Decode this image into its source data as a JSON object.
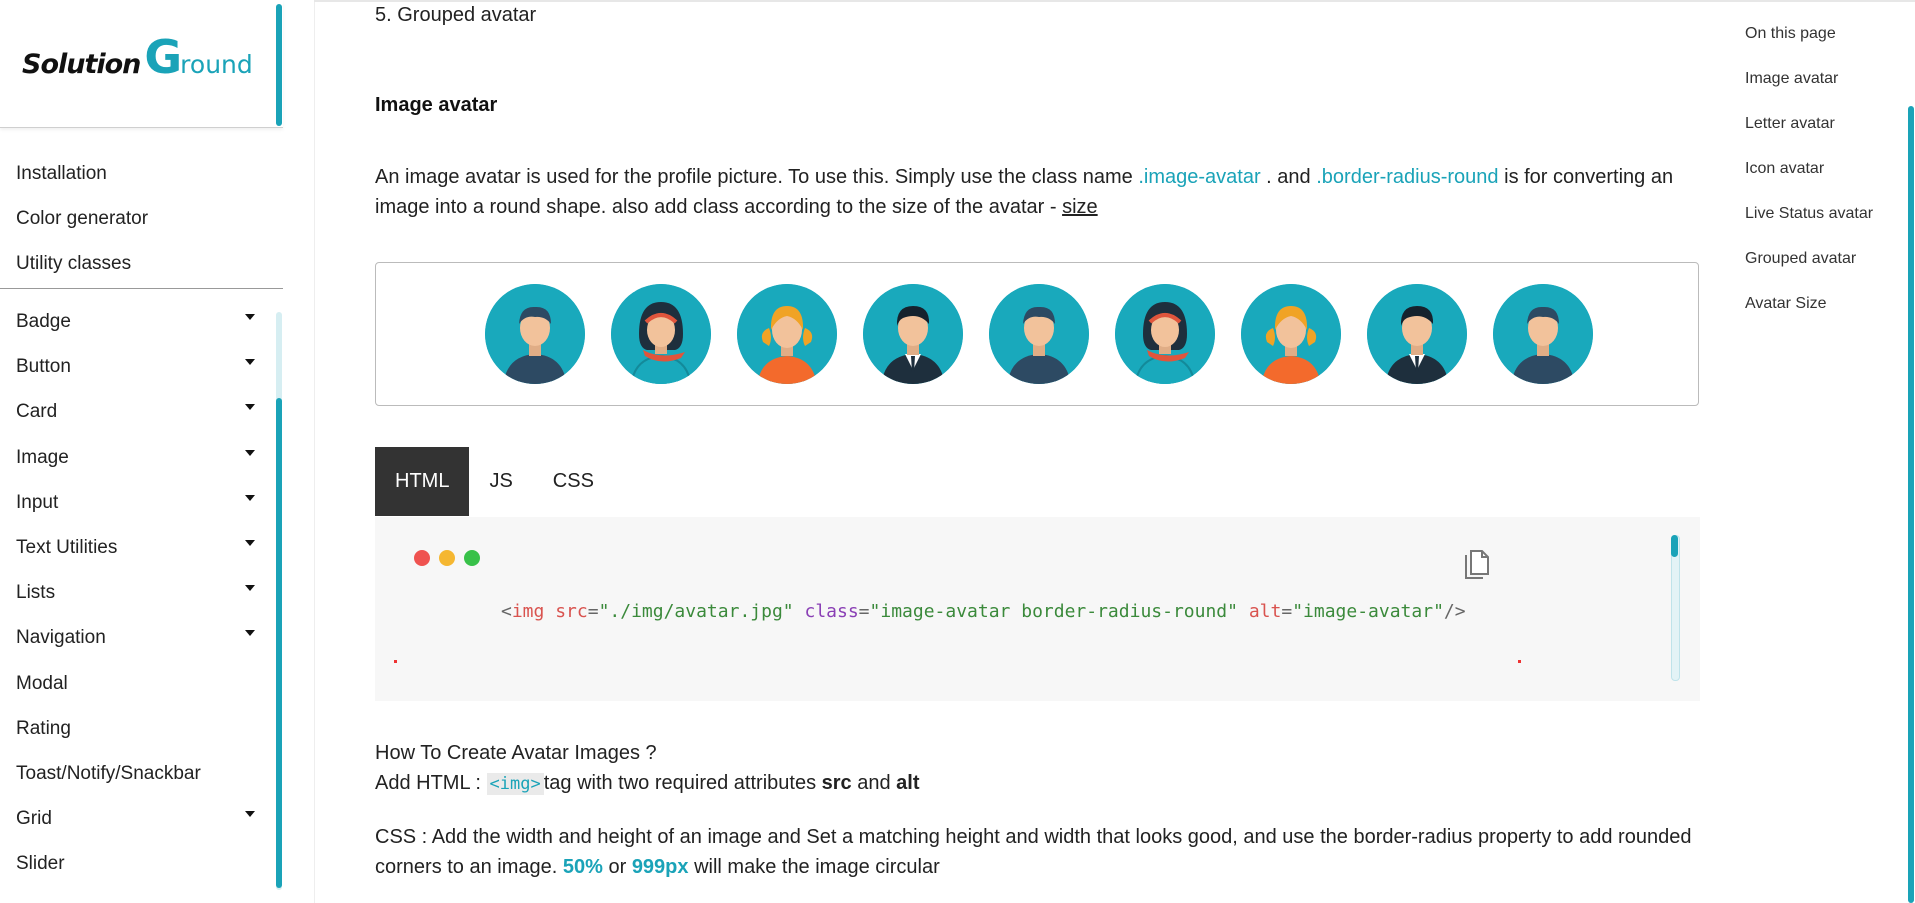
{
  "brand": {
    "logo_text_1": "Solution",
    "logo_text_2": "G",
    "logo_text_3": "round"
  },
  "sidebar": {
    "top_links": [
      "Installation",
      "Color generator",
      "Utility classes"
    ],
    "menu": [
      {
        "label": "Badge",
        "expandable": true
      },
      {
        "label": "Button",
        "expandable": true
      },
      {
        "label": "Card",
        "expandable": true
      },
      {
        "label": "Image",
        "expandable": true
      },
      {
        "label": "Input",
        "expandable": true
      },
      {
        "label": "Text Utilities",
        "expandable": true
      },
      {
        "label": "Lists",
        "expandable": true
      },
      {
        "label": "Navigation",
        "expandable": true
      },
      {
        "label": "Modal",
        "expandable": false
      },
      {
        "label": "Rating",
        "expandable": false
      },
      {
        "label": "Toast/Notify/Snackbar",
        "expandable": false
      },
      {
        "label": "Grid",
        "expandable": true
      },
      {
        "label": "Slider",
        "expandable": false
      }
    ]
  },
  "content": {
    "prev_item": "5. Grouped avatar",
    "section_title": "Image avatar",
    "desc_1": "An image avatar is used for the profile picture. To use this. Simply use the class name ",
    "desc_class_1": ".image-avatar",
    "desc_2": " . and ",
    "desc_class_2": ".border-radius-round",
    "desc_3": " is for converting an image into a round shape. also add class according to the size of the avatar - ",
    "desc_link": "size",
    "avatars": [
      "male-short-hair",
      "female-headband",
      "female-blonde",
      "male-suit",
      "male-short-hair",
      "female-headband",
      "female-blonde",
      "male-suit",
      "male-short-hair"
    ],
    "tabs": [
      {
        "label": "HTML",
        "active": true
      },
      {
        "label": "JS",
        "active": false
      },
      {
        "label": "CSS",
        "active": false
      }
    ],
    "code": {
      "open": "<",
      "tag": "img",
      "attr1": "src",
      "eq": "=",
      "val1": "\"./img/avatar.jpg\"",
      "attr2": "class",
      "val2": "\"image-avatar border-radius-round\"",
      "attr3": "alt",
      "val3": "\"image-avatar\"",
      "close": "/>"
    },
    "how_title": "How To Create Avatar Images ?",
    "add_html_1": "Add HTML : ",
    "add_html_chip": "<img>",
    "add_html_2": "tag with two required attributes ",
    "add_html_src": "src",
    "add_html_and": " and ",
    "add_html_alt": "alt",
    "css_1": "CSS : Add the width and height of an image and Set a matching height and width that looks good, and use the border-radius property to add rounded corners to an image. ",
    "css_hl_1": "50%",
    "css_or": " or ",
    "css_hl_2": "999px",
    "css_2": " will make the image circular"
  },
  "toc": {
    "title": "On this page",
    "items": [
      "Image avatar",
      "Letter avatar",
      "Icon avatar",
      "Live Status avatar",
      "Grouped avatar",
      "Avatar Size"
    ]
  },
  "colors": {
    "accent": "#1aa3b8",
    "avatar_bg": "#19a9bc",
    "tab_active": "#333333"
  }
}
